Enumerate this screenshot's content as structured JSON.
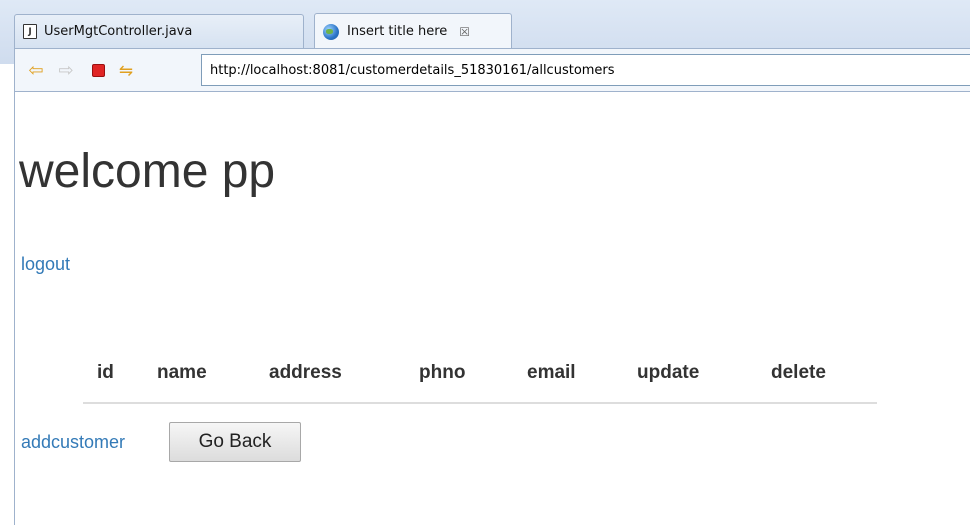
{
  "tabs": [
    {
      "label": "UserMgtController.java",
      "icon": "java-file-icon",
      "active": false
    },
    {
      "label": "Insert title here",
      "icon": "globe-icon",
      "active": true
    }
  ],
  "tab_close_glyph": "☒",
  "toolbar": {
    "back_glyph": "⇦",
    "forward_glyph": "⇨",
    "refresh_glyph": "⇋",
    "address": "http://localhost:8081/customerdetails_51830161/allcustomers"
  },
  "page": {
    "welcome": "welcome pp",
    "logout": "logout",
    "table": {
      "headers": [
        "id",
        "name",
        "address",
        "phno",
        "email",
        "update",
        "delete"
      ],
      "rows": []
    },
    "addcustomer": "addcustomer",
    "go_back": "Go Back"
  },
  "colors": {
    "link": "#337ab7",
    "text": "#333333"
  }
}
